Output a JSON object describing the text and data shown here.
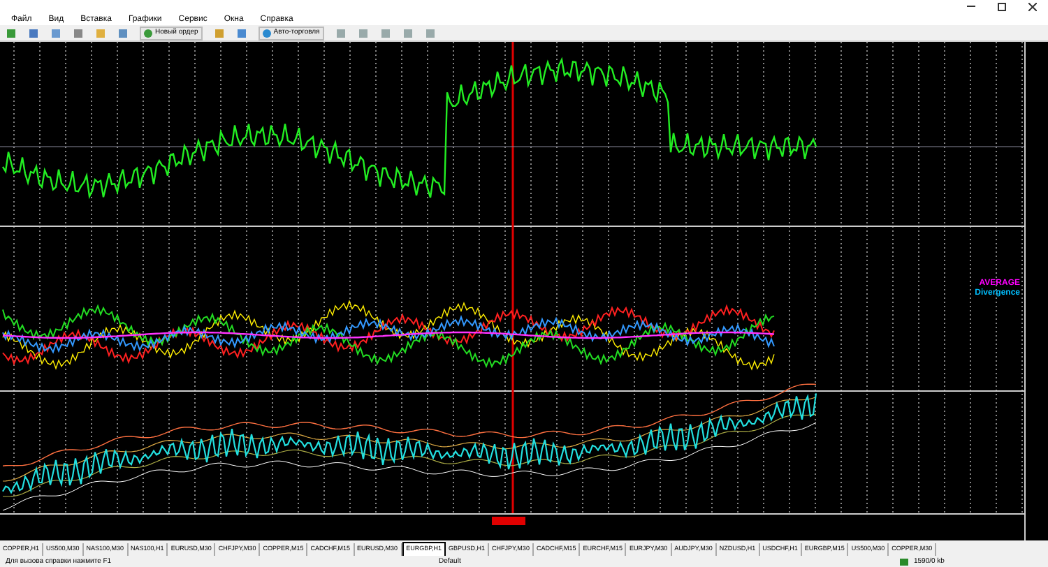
{
  "menu": [
    "Файл",
    "Вид",
    "Вставка",
    "Графики",
    "Сервис",
    "Окна",
    "Справка"
  ],
  "toolbar": {
    "new_order": "Новый ордер",
    "auto_trading": "Авто-торговля"
  },
  "legend": [
    {
      "label": "AVERAGE",
      "color": "#ff00ff"
    },
    {
      "label": "Divergence",
      "color": "#00bfff"
    }
  ],
  "tabs": [
    {
      "label": "COPPER,H1",
      "selected": false
    },
    {
      "label": "US500,M30",
      "selected": false
    },
    {
      "label": "NAS100,M30",
      "selected": false
    },
    {
      "label": "NAS100,H1",
      "selected": false
    },
    {
      "label": "EURUSD,M30",
      "selected": false
    },
    {
      "label": "CHFJPY,M30",
      "selected": false
    },
    {
      "label": "COPPER,M15",
      "selected": false
    },
    {
      "label": "CADCHF,M15",
      "selected": false
    },
    {
      "label": "EURUSD,M30",
      "selected": false
    },
    {
      "label": "EURGBP,H1",
      "selected": true
    },
    {
      "label": "GBPUSD,H1",
      "selected": false
    },
    {
      "label": "CHFJPY,M30",
      "selected": false
    },
    {
      "label": "CADCHF,M15",
      "selected": false
    },
    {
      "label": "EURCHF,M15",
      "selected": false
    },
    {
      "label": "EURJPY,M30",
      "selected": false
    },
    {
      "label": "AUDJPY,M30",
      "selected": false
    },
    {
      "label": "NZDUSD,H1",
      "selected": false
    },
    {
      "label": "USDCHF,H1",
      "selected": false
    },
    {
      "label": "EURGBP,M15",
      "selected": false
    },
    {
      "label": "US500,M30",
      "selected": false
    },
    {
      "label": "COPPER,M30",
      "selected": false
    }
  ],
  "status_bar": {
    "hint": "Для вызова справки нажмите F1",
    "profile": "Default",
    "traffic": "1590/0 kb"
  }
}
